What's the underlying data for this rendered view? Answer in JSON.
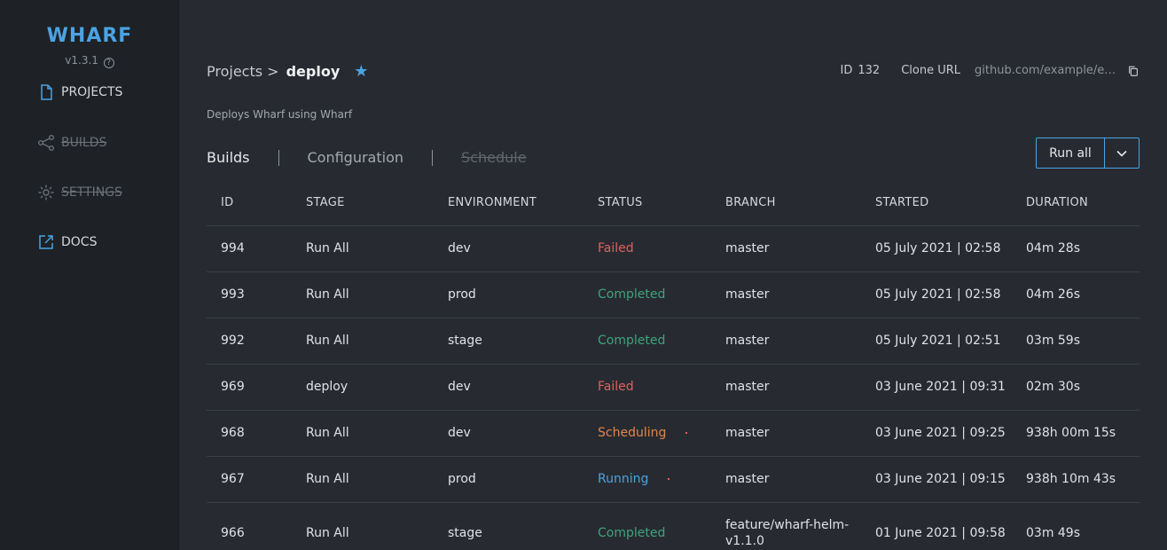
{
  "app": {
    "brand": "WHARF",
    "version": "v1.3.1",
    "help_glyph": "?"
  },
  "sidebar": {
    "items": [
      {
        "label": "PROJECTS",
        "icon": "file-icon",
        "disabled": false
      },
      {
        "label": "BUILDS",
        "icon": "share-icon",
        "disabled": true
      },
      {
        "label": "SETTINGS",
        "icon": "gear-icon",
        "disabled": true
      },
      {
        "label": "DOCS",
        "icon": "external-link-icon",
        "disabled": false
      }
    ]
  },
  "header": {
    "breadcrumb_parent": "Projects >",
    "breadcrumb_current": "deploy",
    "star_glyph": "★",
    "id_label": "ID",
    "id_value": "132",
    "clone_label": "Clone URL",
    "clone_value": "github.com/example/example.git",
    "description": "Deploys Wharf using Wharf"
  },
  "tabs": [
    {
      "label": "Builds",
      "state": "active"
    },
    {
      "label": "Configuration",
      "state": "normal"
    },
    {
      "label": "Schedule",
      "state": "disabled"
    }
  ],
  "actions": {
    "run_all_label": "Run all"
  },
  "table": {
    "columns": [
      "ID",
      "STAGE",
      "ENVIRONMENT",
      "STATUS",
      "BRANCH",
      "STARTED",
      "DURATION"
    ],
    "rows": [
      {
        "id": "994",
        "stage": "Run All",
        "env": "dev",
        "status": "Failed",
        "branch": "master",
        "started": "05 July 2021 | 02:58",
        "duration": "04m 28s"
      },
      {
        "id": "993",
        "stage": "Run All",
        "env": "prod",
        "status": "Completed",
        "branch": "master",
        "started": "05 July 2021 | 02:58",
        "duration": "04m 26s"
      },
      {
        "id": "992",
        "stage": "Run All",
        "env": "stage",
        "status": "Completed",
        "branch": "master",
        "started": "05 July 2021 | 02:51",
        "duration": "03m 59s"
      },
      {
        "id": "969",
        "stage": "deploy",
        "env": "dev",
        "status": "Failed",
        "branch": "master",
        "started": "03 June 2021 | 09:31",
        "duration": "02m 30s"
      },
      {
        "id": "968",
        "stage": "Run All",
        "env": "dev",
        "status": "Scheduling",
        "branch": "master",
        "started": "03 June 2021 | 09:25",
        "duration": "938h 00m 15s"
      },
      {
        "id": "967",
        "stage": "Run All",
        "env": "prod",
        "status": "Running",
        "branch": "master",
        "started": "03 June 2021 | 09:15",
        "duration": "938h 10m 43s"
      },
      {
        "id": "966",
        "stage": "Run All",
        "env": "stage",
        "status": "Completed",
        "branch": "feature/wharf-helm-v1.1.0",
        "started": "01 June 2021 | 09:58",
        "duration": "03m 49s"
      }
    ]
  },
  "colors": {
    "accent": "#4ba3e3",
    "failed": "#e0605f",
    "completed": "#3fa37b",
    "scheduling": "#e1844c",
    "running": "#4ba3e3"
  }
}
